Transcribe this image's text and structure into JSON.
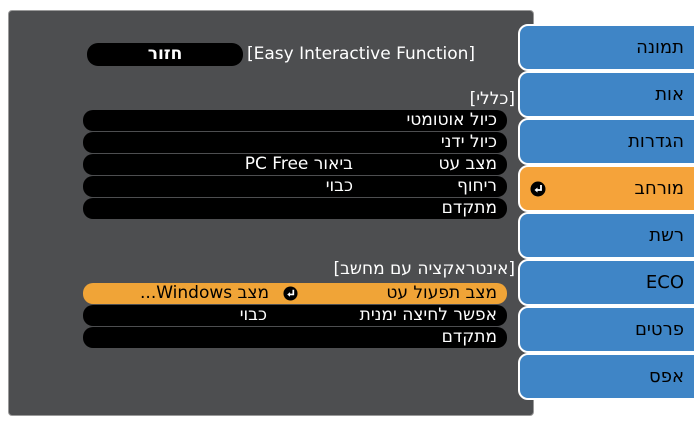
{
  "header": {
    "back_label": "חזור",
    "title": "[Easy Interactive Function]"
  },
  "sections": {
    "general_heading": "[כללי]",
    "pc_heading": "[אינטראקציה עם מחשב]"
  },
  "general_rows": [
    {
      "label": "כיול אוטומטי",
      "value": ""
    },
    {
      "label": "כיול ידני",
      "value": ""
    },
    {
      "label": "מצב עט",
      "value": "ביאור PC Free"
    },
    {
      "label": "ריחוף",
      "value": "כבוי"
    },
    {
      "label": "מתקדם",
      "value": ""
    }
  ],
  "pc_rows": [
    {
      "label": "מצב תפעול עט",
      "value": "מצב Windows...",
      "selected": true
    },
    {
      "label": "אפשר לחיצה ימנית",
      "value": "כבוי",
      "selected": false
    },
    {
      "label": "מתקדם",
      "value": "",
      "selected": false
    }
  ],
  "sidebar": {
    "tabs": [
      {
        "label": "תמונה",
        "active": false
      },
      {
        "label": "אות",
        "active": false
      },
      {
        "label": "הגדרות",
        "active": false
      },
      {
        "label": "מורחב",
        "active": true
      },
      {
        "label": "רשת",
        "active": false
      },
      {
        "label": "ECO",
        "active": false
      },
      {
        "label": "פרטים",
        "active": false
      },
      {
        "label": "אפס",
        "active": false
      }
    ]
  },
  "colors": {
    "panel": "#4d4e50",
    "row": "#000000",
    "selected": "#f0a437",
    "tab": "#3f85c6",
    "tab_active": "#f5a33a"
  },
  "icons": {
    "enter": "enter-icon"
  }
}
